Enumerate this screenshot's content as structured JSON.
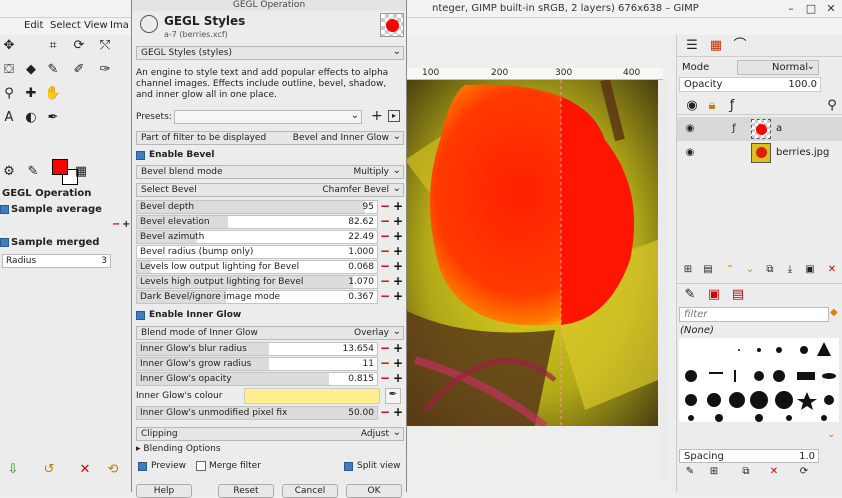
{
  "main_window": {
    "title": "nteger, GIMP built-in sRGB, 2 layers) 676x638 – GIMP",
    "controls": [
      "–",
      "□",
      "✕"
    ]
  },
  "menu": [
    "Edit",
    "Select",
    "View",
    "Ima"
  ],
  "toolbox": {
    "tool_options_title": "GEGL Operation",
    "sample_average": "Sample average",
    "radius_label": "Radius",
    "radius_value": "3",
    "sample_merged": "Sample merged"
  },
  "ruler": [
    "100",
    "200",
    "300",
    "400"
  ],
  "right_panel": {
    "mode_label": "Mode",
    "mode_value": "Normal",
    "opacity_label": "Opacity",
    "opacity_value": "100.0",
    "layers": [
      {
        "name": "a"
      },
      {
        "name": "berries.jpg"
      }
    ],
    "brush_filter_placeholder": "filter",
    "brush_name": "(None)",
    "spacing_label": "Spacing",
    "spacing_value": "1.0"
  },
  "dialog": {
    "window_title": "GEGL Operation",
    "heading": "GEGL Styles",
    "subheading": "a-7 (berries.xcf)",
    "operation": "GEGL Styles (styles)",
    "description": "An engine to style text and add popular effects to alpha channel images. Effects include outline, bevel, shadow, and inner glow all in one place.",
    "presets_label": "Presets:",
    "part_label": "Part of filter to be displayed",
    "part_value": "Bevel and Inner Glow",
    "enable_bevel": "Enable Bevel",
    "bevel_blend_label": "Bevel blend mode",
    "bevel_blend_value": "Multiply",
    "select_bevel_label": "Select Bevel",
    "select_bevel_value": "Chamfer Bevel",
    "bevel_sliders": [
      {
        "label": "Bevel depth",
        "value": "95",
        "fraction": 0.95
      },
      {
        "label": "Bevel elevation",
        "value": "82.62",
        "fraction": 0.38
      },
      {
        "label": "Bevel azimuth",
        "value": "22.49",
        "fraction": 0.25
      },
      {
        "label": "Bevel radius (bump only)",
        "value": "1.000",
        "fraction": 0.0
      },
      {
        "label": "Levels low output lighting for Bevel",
        "value": "0.068",
        "fraction": 0.06
      },
      {
        "label": "Levels high output lighting for Bevel",
        "value": "1.070",
        "fraction": 0.9
      },
      {
        "label": "Dark Bevel/ignore image mode",
        "value": "0.367",
        "fraction": 0.37
      }
    ],
    "enable_inner_glow": "Enable Inner Glow",
    "inner_glow_blend_label": "Blend mode of Inner Glow",
    "inner_glow_blend_value": "Overlay",
    "glow_sliders": [
      {
        "label": "Inner Glow's blur radius",
        "value": "13.654",
        "fraction": 0.55
      },
      {
        "label": "Inner Glow's grow radius",
        "value": "11",
        "fraction": 0.55
      },
      {
        "label": "Inner Glow's opacity",
        "value": "0.815",
        "fraction": 0.8
      }
    ],
    "inner_glow_colour_label": "Inner Glow's colour",
    "inner_glow_colour": "#fff08f",
    "unmodified_label": "Inner Glow's unmodified pixel fix",
    "unmodified_value": "50.00",
    "clipping_label": "Clipping",
    "clipping_value": "Adjust",
    "blending_options": "Blending Options",
    "preview": "Preview",
    "merge_filter": "Merge filter",
    "split_view": "Split view",
    "buttons": [
      "Help",
      "Reset",
      "Cancel",
      "OK"
    ]
  }
}
